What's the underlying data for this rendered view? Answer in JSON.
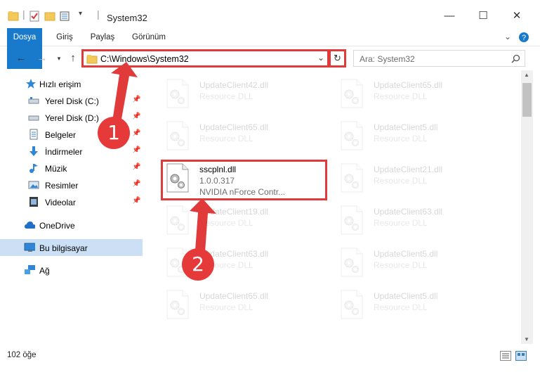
{
  "window": {
    "title": "System32",
    "controls": {
      "minimize": "—",
      "maximize": "☐",
      "close": "✕"
    }
  },
  "ribbon": {
    "tabs": [
      "Dosya",
      "Giriş",
      "Paylaş",
      "Görünüm"
    ],
    "expand_icon": "chevron-down-icon",
    "help_icon": "help-icon"
  },
  "address_bar": {
    "path": "C:\\Windows\\System32",
    "search_placeholder": "Ara: System32"
  },
  "navigation": {
    "items": [
      {
        "label": "Hızlı erişim",
        "icon": "star-icon",
        "pinned": false
      },
      {
        "label": "Yerel Disk (C:)",
        "icon": "drive-icon",
        "pinned": true
      },
      {
        "label": "Yerel Disk (D:)",
        "icon": "drive-icon",
        "pinned": true
      },
      {
        "label": "Belgeler",
        "icon": "documents-icon",
        "pinned": true
      },
      {
        "label": "İndirmeler",
        "icon": "download-icon",
        "pinned": true
      },
      {
        "label": "Müzik",
        "icon": "music-icon",
        "pinned": true
      },
      {
        "label": "Resimler",
        "icon": "pictures-icon",
        "pinned": true
      },
      {
        "label": "Videolar",
        "icon": "videos-icon",
        "pinned": true
      },
      {
        "label": "OneDrive",
        "icon": "cloud-icon",
        "pinned": false
      },
      {
        "label": "Bu bilgisayar",
        "icon": "computer-icon",
        "pinned": false,
        "selected": true
      },
      {
        "label": "Ağ",
        "icon": "network-icon",
        "pinned": false
      }
    ]
  },
  "files": [
    {
      "name": "UpdateClient42.dll",
      "desc": "Resource DLL",
      "faded": true
    },
    {
      "name": "UpdateClient65.dll",
      "desc": "Resource DLL",
      "faded": true
    },
    {
      "name": "UpdateClient65.dll",
      "desc": "Resource DLL",
      "faded": true
    },
    {
      "name": "UpdateClient5.dll",
      "desc": "Resource DLL",
      "faded": true
    },
    {
      "name": "sscplnl.dll",
      "desc": "1.0.0.317",
      "desc2": "NVIDIA nForce Contr...",
      "faded": false,
      "highlighted": true
    },
    {
      "name": "UpdateClient21.dll",
      "desc": "Resource DLL",
      "faded": true
    },
    {
      "name": "UpdateClient19.dll",
      "desc": "Resource DLL",
      "faded": true
    },
    {
      "name": "UpdateClient63.dll",
      "desc": "Resource DLL",
      "faded": true
    },
    {
      "name": "UpdateClient63.dll",
      "desc": "Resource DLL",
      "faded": true
    },
    {
      "name": "UpdateClient5.dll",
      "desc": "Resource DLL",
      "faded": true
    },
    {
      "name": "UpdateClient65.dll",
      "desc": "Resource DLL",
      "faded": true
    },
    {
      "name": "UpdateClient5.dll",
      "desc": "Resource DLL",
      "faded": true
    }
  ],
  "status_bar": {
    "item_count": "102 öğe"
  },
  "annotations": {
    "callout_1": "1",
    "callout_2": "2",
    "color": "#e03a3a"
  }
}
